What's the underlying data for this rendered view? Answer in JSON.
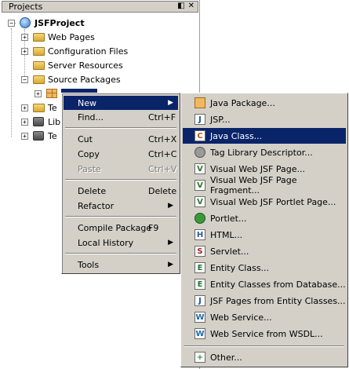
{
  "panel": {
    "title": "Projects",
    "controls": [
      "◧",
      "✕"
    ]
  },
  "tree": {
    "root": "JSFProject",
    "items": [
      "Web Pages",
      "Configuration Files",
      "Server Resources",
      "Source Packages"
    ],
    "selected_package": "",
    "partial": [
      "Te",
      "Lib",
      "Te"
    ]
  },
  "context_menu": {
    "items": [
      {
        "label": "New",
        "accel": "",
        "submenu": true,
        "state": "active"
      },
      {
        "label": "Find...",
        "accel": "Ctrl+F"
      },
      {
        "label": "Cut",
        "accel": "Ctrl+X"
      },
      {
        "label": "Copy",
        "accel": "Ctrl+C"
      },
      {
        "label": "Paste",
        "accel": "Ctrl+V",
        "state": "disabled"
      },
      {
        "label": "Delete",
        "accel": "Delete"
      },
      {
        "label": "Refactor",
        "accel": "",
        "submenu": true
      },
      {
        "label": "Compile Package",
        "accel": "F9"
      },
      {
        "label": "Local History",
        "accel": "",
        "submenu": true
      },
      {
        "label": "Tools",
        "accel": "",
        "submenu": true
      }
    ]
  },
  "submenu": {
    "items": [
      {
        "label": "Java Package...",
        "icon": "java-package-icon"
      },
      {
        "label": "JSP...",
        "icon": "jsp-icon"
      },
      {
        "label": "Java Class...",
        "icon": "java-class-icon",
        "state": "active"
      },
      {
        "label": "Tag Library Descriptor...",
        "icon": "tag-library-icon"
      },
      {
        "label": "Visual Web JSF Page...",
        "icon": "visual-web-page-icon"
      },
      {
        "label": "Visual Web JSF Page Fragment...",
        "icon": "visual-web-fragment-icon"
      },
      {
        "label": "Visual Web JSF Portlet Page...",
        "icon": "visual-web-portlet-icon"
      },
      {
        "label": "Portlet...",
        "icon": "portlet-icon"
      },
      {
        "label": "HTML...",
        "icon": "html-icon"
      },
      {
        "label": "Servlet...",
        "icon": "servlet-icon"
      },
      {
        "label": "Entity Class...",
        "icon": "entity-class-icon"
      },
      {
        "label": "Entity Classes from Database...",
        "icon": "entity-db-icon"
      },
      {
        "label": "JSF Pages from Entity Classes...",
        "icon": "jsf-pages-icon"
      },
      {
        "label": "Web Service...",
        "icon": "web-service-icon"
      },
      {
        "label": "Web Service from WSDL...",
        "icon": "wsdl-icon"
      },
      {
        "label": "Other...",
        "icon": "other-icon"
      }
    ]
  },
  "colors": {
    "menu_bg": "#d4d0c8",
    "highlight": "#0a246a",
    "highlight_text": "#ffffff"
  }
}
